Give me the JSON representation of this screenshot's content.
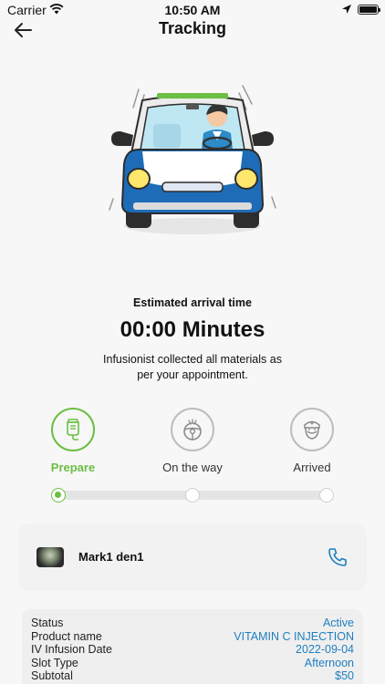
{
  "status_bar": {
    "carrier": "Carrier",
    "time": "10:50 AM"
  },
  "header": {
    "title": "Tracking"
  },
  "eta": {
    "label": "Estimated arrival time",
    "value": "00:00 Minutes",
    "note": "Infusionist collected all materials as per your appointment."
  },
  "steps": [
    {
      "label": "Prepare",
      "icon": "iv-bag-icon",
      "active": true
    },
    {
      "label": "On the way",
      "icon": "steering-wheel-icon",
      "active": false
    },
    {
      "label": "Arrived",
      "icon": "nurse-icon",
      "active": false
    }
  ],
  "progress": {
    "current_step": 1,
    "total_steps": 3
  },
  "provider": {
    "name": "Mark1 den1"
  },
  "details": [
    {
      "label": "Status",
      "value": "Active"
    },
    {
      "label": "Product name",
      "value": "VITAMIN C INJECTION"
    },
    {
      "label": "IV Infusion Date",
      "value": "2022-09-04"
    },
    {
      "label": "Slot Type",
      "value": "Afternoon"
    },
    {
      "label": "Subtotal",
      "value": "$50"
    }
  ],
  "colors": {
    "accent_green": "#6cbe45",
    "link_blue": "#1e7fc0",
    "car_blue": "#1e6cb8"
  }
}
